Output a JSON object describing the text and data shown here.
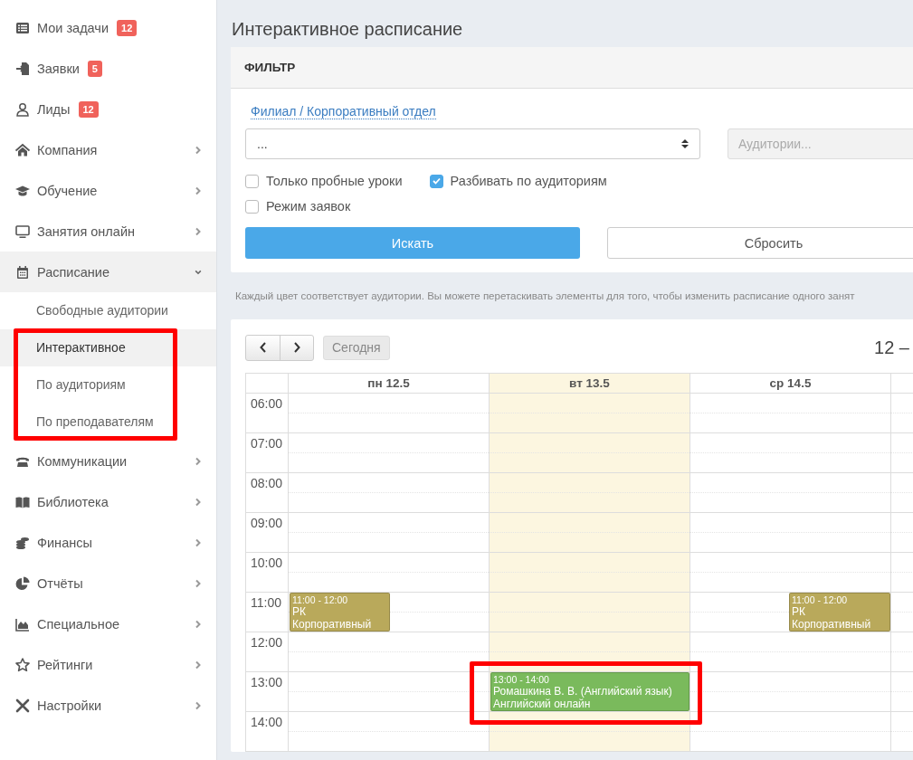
{
  "sidebar": {
    "items": [
      {
        "kind": "link",
        "label": "Мои задачи",
        "badge": "12"
      },
      {
        "kind": "link",
        "label": "Заявки",
        "badge": "5"
      },
      {
        "kind": "link",
        "label": "Лиды",
        "badge": "12"
      },
      {
        "kind": "menu",
        "label": "Компания",
        "expanded": false
      },
      {
        "kind": "menu",
        "label": "Обучение",
        "expanded": false
      },
      {
        "kind": "menu",
        "label": "Занятия онлайн",
        "expanded": false
      },
      {
        "kind": "menu",
        "label": "Расписание",
        "expanded": true,
        "children": [
          {
            "label": "Свободные аудитории",
            "selected": false
          },
          {
            "label": "Интерактивное",
            "selected": true
          },
          {
            "label": "По аудиториям",
            "selected": false
          },
          {
            "label": "По преподавателям",
            "selected": false
          }
        ]
      },
      {
        "kind": "menu",
        "label": "Коммуникации",
        "expanded": false
      },
      {
        "kind": "menu",
        "label": "Библиотека",
        "expanded": false
      },
      {
        "kind": "menu",
        "label": "Финансы",
        "expanded": false
      },
      {
        "kind": "menu",
        "label": "Отчёты",
        "expanded": false
      },
      {
        "kind": "menu",
        "label": "Специальное",
        "expanded": false
      },
      {
        "kind": "menu",
        "label": "Рейтинги",
        "expanded": false
      },
      {
        "kind": "menu",
        "label": "Настройки",
        "expanded": false
      }
    ]
  },
  "page": {
    "title": "Интерактивное расписание"
  },
  "filter": {
    "title": "ФИЛЬТР",
    "branch_label": "Филиал / Корпоративный отдел",
    "branch_select": {
      "value": "..."
    },
    "rooms_field": {
      "placeholder": "Аудитории...",
      "disabled": true
    },
    "checkboxes": [
      {
        "label": "Только пробные уроки",
        "checked": false
      },
      {
        "label": "Разбивать по аудиториям",
        "checked": true
      },
      {
        "label": "Режим заявок",
        "checked": false
      }
    ],
    "buttons": [
      {
        "kind": "primary",
        "label": "Искать"
      },
      {
        "kind": "default",
        "label": "Сбросить"
      }
    ]
  },
  "hint": "Каждый цвет соответствует аудитории. Вы можете перетаскивать элементы для того, чтобы изменить расписание одного занят",
  "calendar": {
    "today_button": "Сегодня",
    "range_title": "12 –",
    "days": [
      {
        "label": "пн 12.5",
        "today": false
      },
      {
        "label": "вт 13.5",
        "today": true
      },
      {
        "label": "ср 14.5",
        "today": false
      },
      {
        "today": false
      }
    ],
    "rows": [
      {
        "time": "06:00"
      },
      {
        "time": "07:00"
      },
      {
        "time": "08:00"
      },
      {
        "time": "09:00"
      },
      {
        "time": "10:00"
      },
      {
        "time": "11:00",
        "cells": [
          {
            "events": [
              {
                "kind": "left",
                "color": "#b9a95b",
                "time": "11:00 - 12:00",
                "title": "РК",
                "subtitle": "Корпоративный"
              }
            ]
          },
          {},
          {
            "events": [
              {
                "kind": "right",
                "color": "#b9a95b",
                "time": "11:00 - 12:00",
                "title": "РК",
                "subtitle": "Корпоративный"
              }
            ]
          },
          {}
        ]
      },
      {
        "time": "12:00"
      },
      {
        "time": "13:00",
        "cells": [
          {},
          {
            "events": [
              {
                "kind": "full",
                "color": "#7aba5c",
                "time": "13:00 - 14:00",
                "title": "Ромашкина В. В. (Английский язык)",
                "subtitle": "Английский онлайн"
              }
            ]
          },
          {},
          {}
        ]
      },
      {
        "time": "14:00"
      }
    ]
  }
}
